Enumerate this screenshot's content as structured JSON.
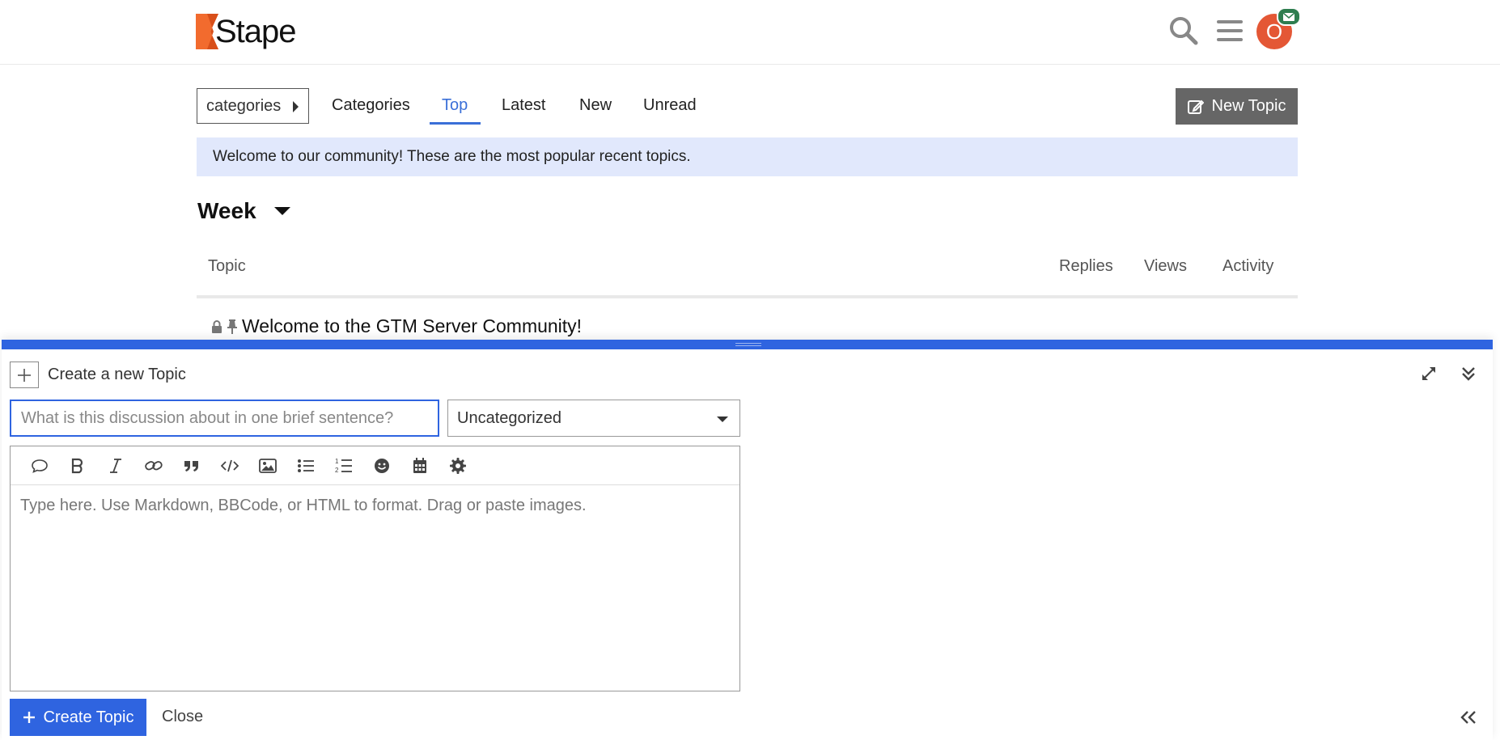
{
  "header": {
    "logo_text": "Stape",
    "avatar_letter": "O",
    "search_icon": "search-icon",
    "menu_icon": "hamburger-icon",
    "notification_icon": "envelope-icon"
  },
  "nav": {
    "categories_dropdown": "categories",
    "items": [
      {
        "label": "Categories"
      },
      {
        "label": "Top"
      },
      {
        "label": "Latest"
      },
      {
        "label": "New"
      },
      {
        "label": "Unread"
      }
    ],
    "active_item": "Top",
    "new_topic_label": "New Topic"
  },
  "banner": "Welcome to our community! These are the most popular recent topics.",
  "period": "Week",
  "table": {
    "headers": {
      "topic": "Topic",
      "replies": "Replies",
      "views": "Views",
      "activity": "Activity"
    },
    "rows": [
      {
        "title": "Welcome to the GTM Server Community!",
        "locked": true,
        "pinned": true
      }
    ]
  },
  "composer": {
    "heading": "Create a new Topic",
    "title_placeholder": "What is this discussion about in one brief sentence?",
    "category_value": "Uncategorized",
    "editor_placeholder": "Type here. Use Markdown, BBCode, or HTML to format. Drag or paste images.",
    "toolbar": [
      "quote-bubble-icon",
      "bold-icon",
      "italic-icon",
      "link-icon",
      "blockquote-icon",
      "code-icon",
      "image-icon",
      "bullet-list-icon",
      "numbered-list-icon",
      "emoji-icon",
      "calendar-icon",
      "gear-icon"
    ],
    "create_label": "Create Topic",
    "close_label": "Close"
  },
  "colors": {
    "accent": "#2f64e0",
    "active_tab": "#3a6fd8",
    "banner_bg": "#e1e8fc",
    "avatar": "#e45735",
    "brand_orange": "#f26b2e",
    "notification": "#2e7d4f"
  }
}
